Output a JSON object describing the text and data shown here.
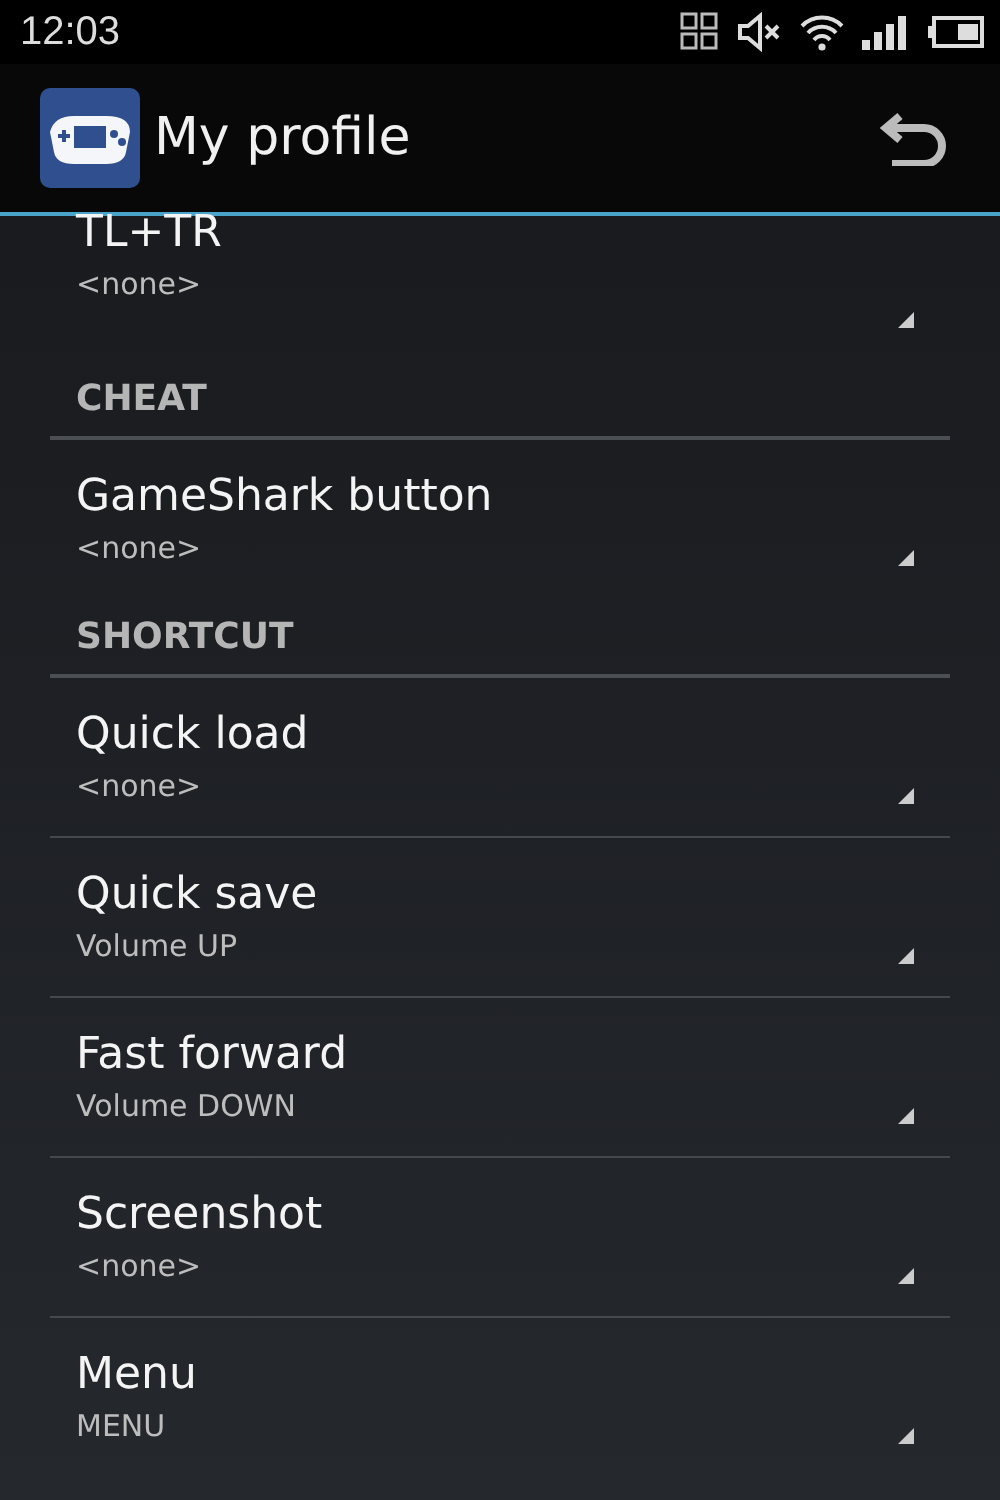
{
  "status_bar": {
    "time": "12:03"
  },
  "action_bar": {
    "title": "My profile"
  },
  "list": [
    {
      "kind": "setting",
      "title": "TL+TR",
      "value": "<none>"
    },
    {
      "kind": "header",
      "title": "CHEAT"
    },
    {
      "kind": "setting",
      "title": "GameShark button",
      "value": "<none>"
    },
    {
      "kind": "header",
      "title": "SHORTCUT"
    },
    {
      "kind": "setting",
      "title": "Quick load",
      "value": "<none>"
    },
    {
      "kind": "setting",
      "title": "Quick save",
      "value": "Volume UP"
    },
    {
      "kind": "setting",
      "title": "Fast forward",
      "value": "Volume DOWN"
    },
    {
      "kind": "setting",
      "title": "Screenshot",
      "value": "<none>"
    },
    {
      "kind": "setting",
      "title": "Menu",
      "value": "MENU"
    }
  ]
}
